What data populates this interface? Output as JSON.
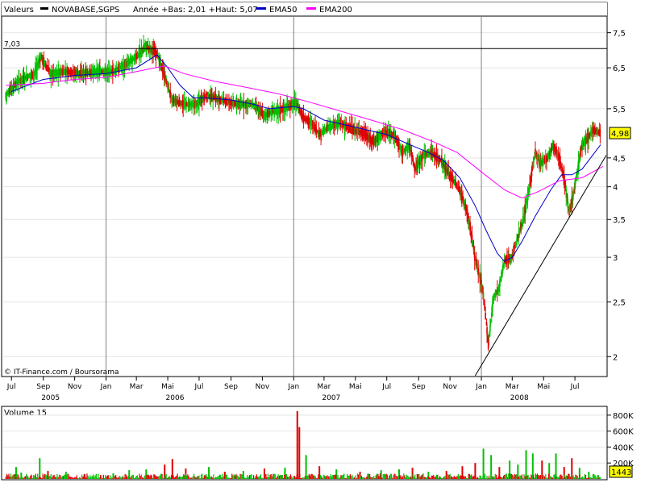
{
  "header": {
    "valeurs_label": "Valeurs",
    "ticker": "NOVABASE,SGPS",
    "range_text": "Année +Bas: 2,01 +Haut: 5,07",
    "ema50_label": "EMA50",
    "ema200_label": "EMA200"
  },
  "colors": {
    "background": "#ffffff",
    "up_candle": "#00c000",
    "down_candle": "#e00000",
    "ema50": "#0000cc",
    "ema200": "#ff00ff",
    "grid": "#808080",
    "trendline": "#000000"
  },
  "watermark": "© IT-Finance.com / Boursorama",
  "reference_line_label": "7,03",
  "last_price_badge": "4,98",
  "volume_panel": {
    "title": "Volume 15",
    "y_ticks": [
      "800K",
      "600K",
      "400K",
      "200K"
    ],
    "last_volume_badge": "1443"
  },
  "chart_data": {
    "type": "candlestick",
    "y_scale": "log",
    "ylim": [
      1.85,
      8.0
    ],
    "y_ticks": [
      "7,5",
      "6,5",
      "5,5",
      "4,5",
      "4",
      "3,5",
      "3",
      "2,5",
      "2"
    ],
    "y_tick_values": [
      7.5,
      6.5,
      5.5,
      4.5,
      4.0,
      3.5,
      3.0,
      2.5,
      2.0
    ],
    "x_range": [
      "2005-06-15",
      "2008-08-31"
    ],
    "month_ticks": [
      {
        "label": "Jul",
        "date": "2005-07-01"
      },
      {
        "label": "Sep",
        "date": "2005-09-01"
      },
      {
        "label": "Nov",
        "date": "2005-11-01"
      },
      {
        "label": "Jan",
        "date": "2006-01-01"
      },
      {
        "label": "Mar",
        "date": "2006-03-01"
      },
      {
        "label": "Mai",
        "date": "2006-05-01"
      },
      {
        "label": "Jul",
        "date": "2006-07-01"
      },
      {
        "label": "Sep",
        "date": "2006-09-01"
      },
      {
        "label": "Nov",
        "date": "2006-11-01"
      },
      {
        "label": "Jan",
        "date": "2007-01-01"
      },
      {
        "label": "Mar",
        "date": "2007-03-01"
      },
      {
        "label": "Mai",
        "date": "2007-05-01"
      },
      {
        "label": "Jul",
        "date": "2007-07-01"
      },
      {
        "label": "Sep",
        "date": "2007-09-01"
      },
      {
        "label": "Nov",
        "date": "2007-11-01"
      },
      {
        "label": "Jan",
        "date": "2008-01-01"
      },
      {
        "label": "Mar",
        "date": "2008-03-01"
      },
      {
        "label": "Mai",
        "date": "2008-05-01"
      },
      {
        "label": "Jul",
        "date": "2008-07-01"
      }
    ],
    "year_labels": [
      {
        "label": "2005",
        "date": "2005-09-15"
      },
      {
        "label": "2006",
        "date": "2006-05-15"
      },
      {
        "label": "2007",
        "date": "2007-03-15"
      },
      {
        "label": "2008",
        "date": "2008-03-15"
      }
    ],
    "year_gridlines": [
      "2006-01-01",
      "2007-01-01",
      "2008-01-01"
    ],
    "reference_line": 7.03,
    "trendline": [
      {
        "date": "2007-12-20",
        "value": 1.85
      },
      {
        "date": "2008-08-31",
        "value": 4.55
      }
    ],
    "price_series": [
      {
        "date": "2005-06-20",
        "value": 5.8
      },
      {
        "date": "2005-07-15",
        "value": 6.15
      },
      {
        "date": "2005-08-15",
        "value": 6.35
      },
      {
        "date": "2005-08-28",
        "value": 6.8
      },
      {
        "date": "2005-09-15",
        "value": 6.35
      },
      {
        "date": "2005-10-15",
        "value": 6.4
      },
      {
        "date": "2005-11-15",
        "value": 6.35
      },
      {
        "date": "2005-12-15",
        "value": 6.4
      },
      {
        "date": "2006-01-15",
        "value": 6.4
      },
      {
        "date": "2006-02-10",
        "value": 6.6
      },
      {
        "date": "2006-03-01",
        "value": 6.8
      },
      {
        "date": "2006-03-20",
        "value": 7.1
      },
      {
        "date": "2006-04-10",
        "value": 6.9
      },
      {
        "date": "2006-04-25",
        "value": 6.3
      },
      {
        "date": "2006-05-10",
        "value": 5.7
      },
      {
        "date": "2006-06-01",
        "value": 5.6
      },
      {
        "date": "2006-06-25",
        "value": 5.6
      },
      {
        "date": "2006-07-15",
        "value": 5.8
      },
      {
        "date": "2006-08-15",
        "value": 5.7
      },
      {
        "date": "2006-09-15",
        "value": 5.6
      },
      {
        "date": "2006-10-15",
        "value": 5.6
      },
      {
        "date": "2006-11-05",
        "value": 5.35
      },
      {
        "date": "2006-11-25",
        "value": 5.45
      },
      {
        "date": "2006-12-15",
        "value": 5.5
      },
      {
        "date": "2007-01-05",
        "value": 5.65
      },
      {
        "date": "2007-01-20",
        "value": 5.3
      },
      {
        "date": "2007-02-05",
        "value": 5.2
      },
      {
        "date": "2007-02-20",
        "value": 4.95
      },
      {
        "date": "2007-03-10",
        "value": 5.1
      },
      {
        "date": "2007-04-01",
        "value": 5.2
      },
      {
        "date": "2007-04-25",
        "value": 5.05
      },
      {
        "date": "2007-05-15",
        "value": 5.0
      },
      {
        "date": "2007-06-05",
        "value": 4.8
      },
      {
        "date": "2007-06-25",
        "value": 5.0
      },
      {
        "date": "2007-07-15",
        "value": 4.95
      },
      {
        "date": "2007-08-01",
        "value": 4.6
      },
      {
        "date": "2007-08-15",
        "value": 4.75
      },
      {
        "date": "2007-08-25",
        "value": 4.3
      },
      {
        "date": "2007-09-10",
        "value": 4.55
      },
      {
        "date": "2007-09-25",
        "value": 4.6
      },
      {
        "date": "2007-10-15",
        "value": 4.45
      },
      {
        "date": "2007-11-01",
        "value": 4.2
      },
      {
        "date": "2007-11-20",
        "value": 3.95
      },
      {
        "date": "2007-12-05",
        "value": 3.6
      },
      {
        "date": "2007-12-20",
        "value": 3.0
      },
      {
        "date": "2008-01-05",
        "value": 2.6
      },
      {
        "date": "2008-01-15",
        "value": 2.1
      },
      {
        "date": "2008-01-25",
        "value": 2.55
      },
      {
        "date": "2008-02-05",
        "value": 2.65
      },
      {
        "date": "2008-02-15",
        "value": 2.95
      },
      {
        "date": "2008-03-01",
        "value": 3.0
      },
      {
        "date": "2008-03-10",
        "value": 3.2
      },
      {
        "date": "2008-03-25",
        "value": 3.55
      },
      {
        "date": "2008-04-05",
        "value": 4.05
      },
      {
        "date": "2008-04-15",
        "value": 4.6
      },
      {
        "date": "2008-04-25",
        "value": 4.4
      },
      {
        "date": "2008-05-10",
        "value": 4.5
      },
      {
        "date": "2008-05-20",
        "value": 4.75
      },
      {
        "date": "2008-05-30",
        "value": 4.55
      },
      {
        "date": "2008-06-10",
        "value": 4.15
      },
      {
        "date": "2008-06-20",
        "value": 3.6
      },
      {
        "date": "2008-06-28",
        "value": 3.85
      },
      {
        "date": "2008-07-05",
        "value": 4.2
      },
      {
        "date": "2008-07-15",
        "value": 4.75
      },
      {
        "date": "2008-07-25",
        "value": 4.85
      },
      {
        "date": "2008-08-05",
        "value": 5.05
      },
      {
        "date": "2008-08-20",
        "value": 4.98
      }
    ],
    "series": [
      {
        "name": "EMA50",
        "points": [
          {
            "date": "2005-07-01",
            "value": 5.9
          },
          {
            "date": "2005-09-01",
            "value": 6.2
          },
          {
            "date": "2005-11-01",
            "value": 6.3
          },
          {
            "date": "2006-01-01",
            "value": 6.35
          },
          {
            "date": "2006-03-01",
            "value": 6.5
          },
          {
            "date": "2006-04-10",
            "value": 6.85
          },
          {
            "date": "2006-05-01",
            "value": 6.5
          },
          {
            "date": "2006-05-25",
            "value": 6.05
          },
          {
            "date": "2006-06-20",
            "value": 5.75
          },
          {
            "date": "2006-07-15",
            "value": 5.75
          },
          {
            "date": "2006-09-01",
            "value": 5.7
          },
          {
            "date": "2006-10-15",
            "value": 5.6
          },
          {
            "date": "2006-11-15",
            "value": 5.5
          },
          {
            "date": "2007-01-01",
            "value": 5.55
          },
          {
            "date": "2007-01-20",
            "value": 5.5
          },
          {
            "date": "2007-03-01",
            "value": 5.25
          },
          {
            "date": "2007-05-01",
            "value": 5.1
          },
          {
            "date": "2007-07-01",
            "value": 4.95
          },
          {
            "date": "2007-08-15",
            "value": 4.75
          },
          {
            "date": "2007-09-20",
            "value": 4.6
          },
          {
            "date": "2007-10-20",
            "value": 4.45
          },
          {
            "date": "2007-11-20",
            "value": 4.15
          },
          {
            "date": "2007-12-20",
            "value": 3.7
          },
          {
            "date": "2008-01-10",
            "value": 3.35
          },
          {
            "date": "2008-02-01",
            "value": 3.05
          },
          {
            "date": "2008-02-15",
            "value": 2.95
          },
          {
            "date": "2008-03-01",
            "value": 3.0
          },
          {
            "date": "2008-03-20",
            "value": 3.2
          },
          {
            "date": "2008-04-15",
            "value": 3.55
          },
          {
            "date": "2008-05-15",
            "value": 3.95
          },
          {
            "date": "2008-06-05",
            "value": 4.2
          },
          {
            "date": "2008-06-25",
            "value": 4.2
          },
          {
            "date": "2008-07-15",
            "value": 4.3
          },
          {
            "date": "2008-08-20",
            "value": 4.75
          }
        ]
      },
      {
        "name": "EMA200",
        "points": [
          {
            "date": "2005-06-20",
            "value": 6.05
          },
          {
            "date": "2005-09-01",
            "value": 6.1
          },
          {
            "date": "2005-11-01",
            "value": 6.2
          },
          {
            "date": "2006-01-01",
            "value": 6.25
          },
          {
            "date": "2006-03-01",
            "value": 6.4
          },
          {
            "date": "2006-04-25",
            "value": 6.55
          },
          {
            "date": "2006-06-01",
            "value": 6.35
          },
          {
            "date": "2006-08-01",
            "value": 6.15
          },
          {
            "date": "2006-10-01",
            "value": 6.0
          },
          {
            "date": "2006-12-01",
            "value": 5.85
          },
          {
            "date": "2007-02-01",
            "value": 5.65
          },
          {
            "date": "2007-04-01",
            "value": 5.45
          },
          {
            "date": "2007-06-01",
            "value": 5.25
          },
          {
            "date": "2007-08-01",
            "value": 5.05
          },
          {
            "date": "2007-10-01",
            "value": 4.8
          },
          {
            "date": "2007-11-15",
            "value": 4.6
          },
          {
            "date": "2008-01-01",
            "value": 4.25
          },
          {
            "date": "2008-02-15",
            "value": 3.95
          },
          {
            "date": "2008-03-20",
            "value": 3.82
          },
          {
            "date": "2008-04-20",
            "value": 3.92
          },
          {
            "date": "2008-06-01",
            "value": 4.1
          },
          {
            "date": "2008-07-15",
            "value": 4.15
          },
          {
            "date": "2008-08-25",
            "value": 4.35
          }
        ]
      }
    ],
    "volume": {
      "ylim": [
        0,
        900000
      ],
      "y_tick_values": [
        800000,
        600000,
        400000,
        200000
      ],
      "bars": [
        {
          "date": "2005-07-10",
          "value": 150000,
          "dir": "up"
        },
        {
          "date": "2005-07-20",
          "value": 80000,
          "dir": "up"
        },
        {
          "date": "2005-08-25",
          "value": 260000,
          "dir": "up"
        },
        {
          "date": "2005-09-10",
          "value": 100000,
          "dir": "down"
        },
        {
          "date": "2005-10-15",
          "value": 90000,
          "dir": "up"
        },
        {
          "date": "2005-11-20",
          "value": 60000,
          "dir": "down"
        },
        {
          "date": "2006-01-15",
          "value": 70000,
          "dir": "up"
        },
        {
          "date": "2006-02-15",
          "value": 110000,
          "dir": "up"
        },
        {
          "date": "2006-03-20",
          "value": 120000,
          "dir": "up"
        },
        {
          "date": "2006-04-25",
          "value": 180000,
          "dir": "down"
        },
        {
          "date": "2006-05-10",
          "value": 250000,
          "dir": "down"
        },
        {
          "date": "2006-06-05",
          "value": 130000,
          "dir": "down"
        },
        {
          "date": "2006-07-20",
          "value": 150000,
          "dir": "up"
        },
        {
          "date": "2006-08-20",
          "value": 90000,
          "dir": "down"
        },
        {
          "date": "2006-09-25",
          "value": 100000,
          "dir": "up"
        },
        {
          "date": "2006-11-05",
          "value": 130000,
          "dir": "down"
        },
        {
          "date": "2006-12-15",
          "value": 140000,
          "dir": "up"
        },
        {
          "date": "2007-01-08",
          "value": 850000,
          "dir": "down"
        },
        {
          "date": "2007-01-12",
          "value": 650000,
          "dir": "down"
        },
        {
          "date": "2007-01-25",
          "value": 300000,
          "dir": "up"
        },
        {
          "date": "2007-02-20",
          "value": 160000,
          "dir": "down"
        },
        {
          "date": "2007-03-25",
          "value": 120000,
          "dir": "up"
        },
        {
          "date": "2007-05-10",
          "value": 90000,
          "dir": "down"
        },
        {
          "date": "2007-06-20",
          "value": 110000,
          "dir": "up"
        },
        {
          "date": "2007-07-25",
          "value": 120000,
          "dir": "up"
        },
        {
          "date": "2007-08-20",
          "value": 140000,
          "dir": "down"
        },
        {
          "date": "2007-09-20",
          "value": 90000,
          "dir": "up"
        },
        {
          "date": "2007-10-25",
          "value": 100000,
          "dir": "down"
        },
        {
          "date": "2007-11-25",
          "value": 160000,
          "dir": "down"
        },
        {
          "date": "2007-12-20",
          "value": 200000,
          "dir": "down"
        },
        {
          "date": "2008-01-05",
          "value": 380000,
          "dir": "up"
        },
        {
          "date": "2008-01-20",
          "value": 300000,
          "dir": "up"
        },
        {
          "date": "2008-02-05",
          "value": 150000,
          "dir": "down"
        },
        {
          "date": "2008-02-25",
          "value": 230000,
          "dir": "up"
        },
        {
          "date": "2008-03-12",
          "value": 180000,
          "dir": "up"
        },
        {
          "date": "2008-03-28",
          "value": 360000,
          "dir": "up"
        },
        {
          "date": "2008-04-10",
          "value": 320000,
          "dir": "up"
        },
        {
          "date": "2008-04-28",
          "value": 230000,
          "dir": "down"
        },
        {
          "date": "2008-05-12",
          "value": 200000,
          "dir": "up"
        },
        {
          "date": "2008-05-25",
          "value": 320000,
          "dir": "up"
        },
        {
          "date": "2008-06-10",
          "value": 150000,
          "dir": "down"
        },
        {
          "date": "2008-06-25",
          "value": 260000,
          "dir": "down"
        },
        {
          "date": "2008-07-10",
          "value": 140000,
          "dir": "up"
        },
        {
          "date": "2008-07-28",
          "value": 90000,
          "dir": "up"
        },
        {
          "date": "2008-08-15",
          "value": 50000,
          "dir": "up"
        }
      ]
    }
  }
}
